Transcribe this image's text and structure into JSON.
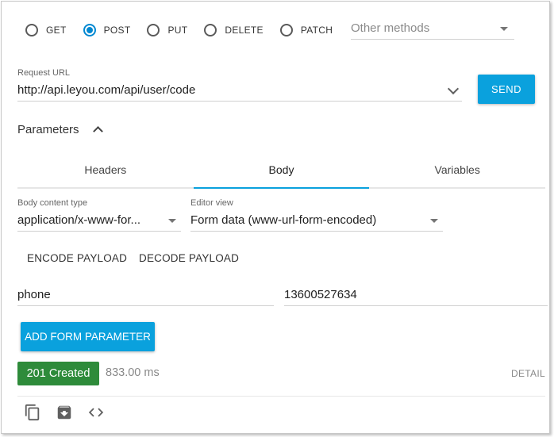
{
  "methods": [
    {
      "label": "GET",
      "checked": false
    },
    {
      "label": "POST",
      "checked": true
    },
    {
      "label": "PUT",
      "checked": false
    },
    {
      "label": "DELETE",
      "checked": false
    },
    {
      "label": "PATCH",
      "checked": false
    }
  ],
  "other_methods": {
    "placeholder": "Other methods"
  },
  "request": {
    "url_label": "Request URL",
    "url": "http://api.leyou.com/api/user/code",
    "send_label": "SEND"
  },
  "parameters": {
    "title": "Parameters",
    "tabs": [
      {
        "label": "Headers",
        "active": false
      },
      {
        "label": "Body",
        "active": true
      },
      {
        "label": "Variables",
        "active": false
      }
    ]
  },
  "body": {
    "content_type_label": "Body content type",
    "content_type": "application/x-www-for...",
    "editor_view_label": "Editor view",
    "editor_view": "Form data (www-url-form-encoded)",
    "encode_label": "ENCODE PAYLOAD",
    "decode_label": "DECODE PAYLOAD",
    "form_params": [
      {
        "key": "phone",
        "value": "13600527634"
      }
    ],
    "add_param_label": "ADD FORM PARAMETER"
  },
  "response": {
    "status": "201 Created",
    "status_color": "#2e8b3a",
    "time": "833.00 ms",
    "details_label": "DETAIL"
  },
  "toolbar": {
    "icons": [
      "copy-icon",
      "save-icon",
      "code-icon"
    ]
  },
  "colors": {
    "accent": "#0aa1dd",
    "radio_active": "#0288d1"
  }
}
